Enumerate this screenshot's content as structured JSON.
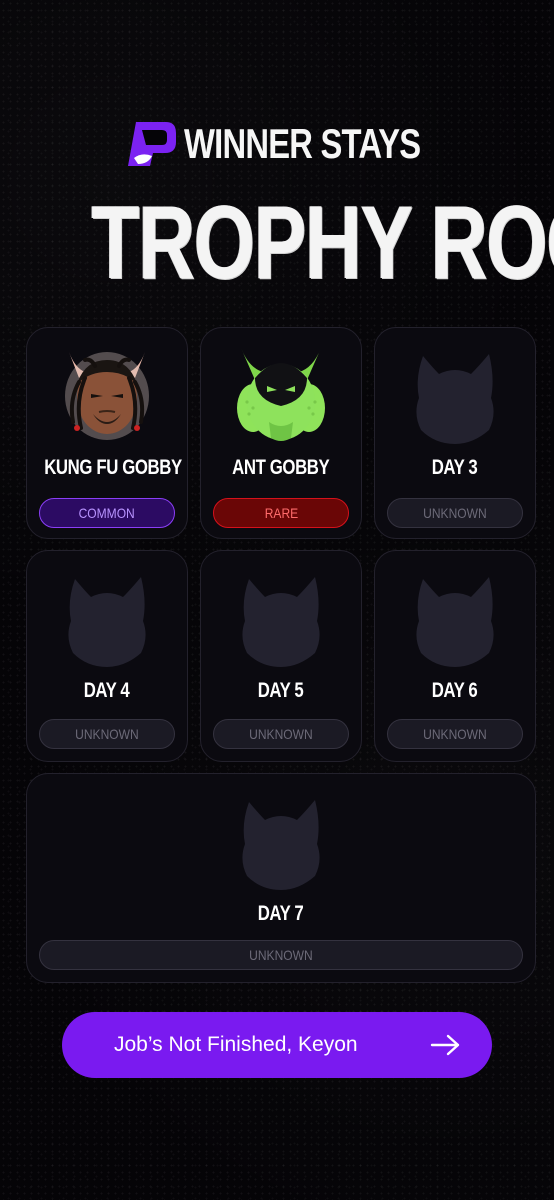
{
  "brand": {
    "name": "WINNER STAYS",
    "logo_icon": "p-logo-icon",
    "accent_color": "#7a1af0"
  },
  "page": {
    "title": "TROPHY ROOM"
  },
  "trophies": [
    {
      "name": "KUNG FU GOBBY",
      "rarity": "COMMON",
      "state": "unlocked",
      "icon": "kung-fu-gobby-avatar"
    },
    {
      "name": "ANT GOBBY",
      "rarity": "RARE",
      "state": "unlocked",
      "icon": "ant-gobby-avatar"
    },
    {
      "name": "DAY 3",
      "rarity": "UNKNOWN",
      "state": "locked",
      "icon": "locked-silhouette-icon"
    },
    {
      "name": "DAY 4",
      "rarity": "UNKNOWN",
      "state": "locked",
      "icon": "locked-silhouette-icon"
    },
    {
      "name": "DAY 5",
      "rarity": "UNKNOWN",
      "state": "locked",
      "icon": "locked-silhouette-icon"
    },
    {
      "name": "DAY 6",
      "rarity": "UNKNOWN",
      "state": "locked",
      "icon": "locked-silhouette-icon"
    },
    {
      "name": "DAY 7",
      "rarity": "UNKNOWN",
      "state": "locked",
      "icon": "locked-silhouette-icon"
    }
  ],
  "colors": {
    "common_badge": "#2c0b63",
    "rare_badge": "#6a0606",
    "unknown_badge": "#1b1a24"
  },
  "cta": {
    "label": "Job’s Not Finished, Keyon",
    "icon": "arrow-right-icon"
  }
}
